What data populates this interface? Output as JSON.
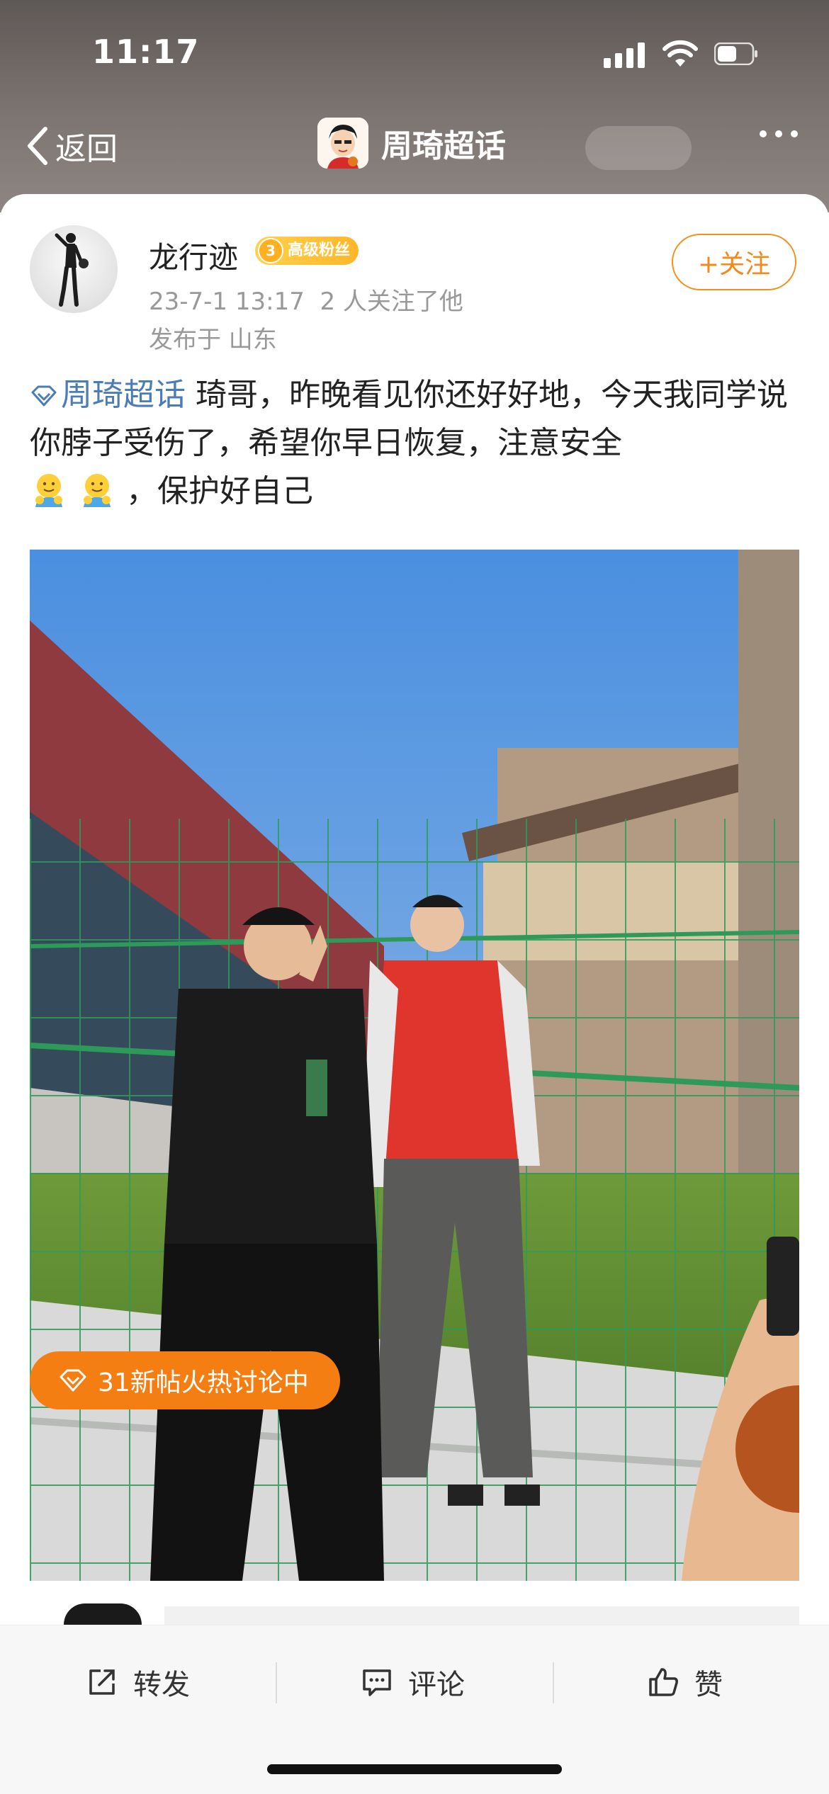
{
  "status": {
    "time": "11:17"
  },
  "nav": {
    "back_label": "返回",
    "title": "周琦超话"
  },
  "post": {
    "username": "龙行迹",
    "badge_level": "3",
    "badge_text": "高级粉丝",
    "date": "23-7-1 13:17",
    "followers_note": "2 人关注了他",
    "location": "发布于 山东",
    "follow_label": "+关注",
    "topic": "周琦超话",
    "text_main": " 琦哥，昨晚看见你还好好地，今天我同学说你脖子受伤了，希望你早日恢复，注意安全",
    "text_tail": "，保护好自己",
    "emoji_count": 2
  },
  "hot": {
    "label": "31新帖火热讨论中"
  },
  "actions": {
    "repost": "转发",
    "comment": "评论",
    "like": "赞"
  },
  "colors": {
    "accent": "#f57e13",
    "topic": "#4a7cb8",
    "badge": "#ffb628"
  }
}
